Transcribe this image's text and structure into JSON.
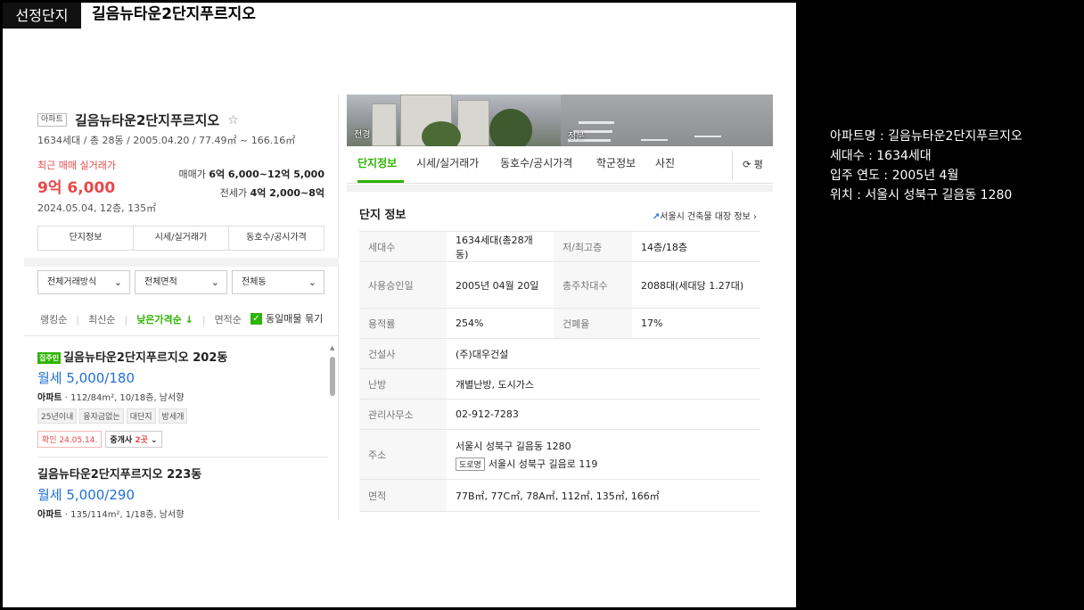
{
  "header": {
    "badge": "선정단지",
    "title": "길음뉴타운2단지푸르지오"
  },
  "side_info": {
    "name": "아파트명 : 길음뉴타운2단지푸르지오",
    "households": "세대수 : 1634세대",
    "move_in": "입주 연도 : 2005년 4월",
    "location": "위치 : 서울시 성북구 길음동 1280"
  },
  "left": {
    "type_tag": "아파트",
    "apt_name": "길음뉴타운2단지푸르지오",
    "star": "☆",
    "meta": "1634세대 / 총 28동 / 2005.04.20 / 77.49㎡ ~ 166.16㎡",
    "recent_label": "최근 매매 실거래가",
    "recent_price": "9억 6,000",
    "recent_date": "2024.05.04, 12층, 135㎡",
    "sale_range_label": "매매가 ",
    "sale_range": "6억 6,000~12억 5,000",
    "jeonse_range_label": "전세가 ",
    "jeonse_range": "4억 2,000~8억",
    "tabs": [
      "단지정보",
      "시세/실거래가",
      "동호수/공시가격"
    ],
    "filters": [
      "전체거래방식",
      "전체면적",
      "전체동"
    ],
    "chevron": "⌄",
    "sort": [
      "랭킹순",
      "최신순",
      "낮은가격순 ↓",
      "면적순"
    ],
    "sort_sep": "|",
    "same_listing_label": "동일매물 묶기",
    "check_mark": "✓",
    "listings": [
      {
        "owner_tag": "집주인",
        "title": "길음뉴타운2단지푸르지오 202동",
        "price": "월세 5,000/180",
        "type": "아파트",
        "desc": " · 112/84m², 10/18층, 남서향",
        "chips": [
          "25년이내",
          "융자금없는",
          "대단지",
          "방세개"
        ],
        "confirm": "확인 24.05.14.",
        "agent_label": "중개사 ",
        "agent_count": "2곳",
        "agent_chev": " ⌄"
      },
      {
        "title": "길음뉴타운2단지푸르지오 223동",
        "price": "월세 5,000/290",
        "type": "아파트",
        "desc": " · 135/114m², 1/18층, 남서향"
      }
    ],
    "scroll_up": "▲"
  },
  "right": {
    "photo_caption_1": "전경",
    "photo_caption_2": "정문",
    "tabs": [
      "단지정보",
      "시세/실거래가",
      "동호수/공시가격",
      "학군정보",
      "사진"
    ],
    "refresh_label": "⟳ 평",
    "section_title": "단지 정보",
    "registry_mark": "↗",
    "registry_link": "서울시 건축물 대장 정보 ›",
    "rows": [
      {
        "h1": "세대수",
        "v1": "1634세대(총28개동)",
        "h2": "저/최고층",
        "v2": "14층/18층"
      },
      {
        "h1": "사용승인일",
        "v1": "2005년 04월 20일",
        "h2": "총주차대수",
        "v2": "2088대(세대당 1.27대)"
      },
      {
        "h1": "용적률",
        "v1": "254%",
        "h2": "건폐율",
        "v2": "17%"
      },
      {
        "h1": "건설사",
        "v1": "(주)대우건설"
      },
      {
        "h1": "난방",
        "v1": "개별난방, 도시가스"
      },
      {
        "h1": "관리사무소",
        "v1": "02-912-7283"
      },
      {
        "h1": "주소",
        "v1": "서울시 성북구 길음동 1280",
        "road_tag": "도로명",
        "road_addr": "서울시 성북구 길음로 119"
      },
      {
        "h1": "면적",
        "v1": "77B㎡, 77C㎡, 78A㎡, 112㎡, 135㎡, 166㎡"
      }
    ]
  }
}
